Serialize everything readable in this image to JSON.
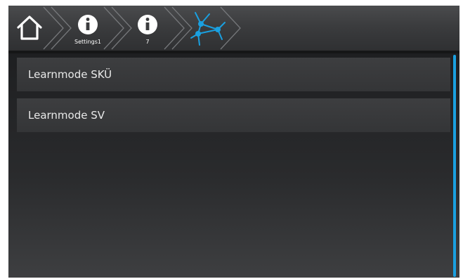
{
  "breadcrumb": [
    {
      "icon": "home-icon",
      "label": ""
    },
    {
      "icon": "info-icon",
      "label": "Settings1"
    },
    {
      "icon": "info-icon",
      "label": "7"
    },
    {
      "icon": "network-icon",
      "label": ""
    }
  ],
  "menu": {
    "items": [
      {
        "label": "Learnmode SKÜ"
      },
      {
        "label": "Learnmode SV"
      }
    ]
  },
  "colors": {
    "accent": "#1aa0e0",
    "topbar": "#3b3c3e",
    "item_bg": "#383a3c",
    "text": "#e9e9e9"
  }
}
